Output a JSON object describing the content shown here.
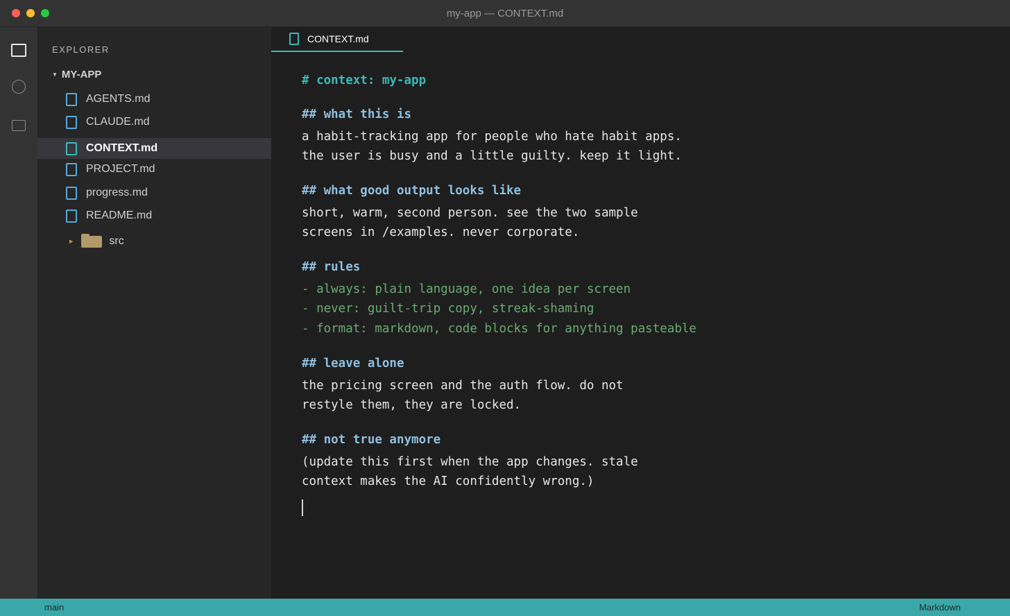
{
  "window": {
    "title": "my-app — CONTEXT.md"
  },
  "activity_bar": {
    "icons": [
      "explorer-icon",
      "search-icon",
      "extensions-icon"
    ]
  },
  "sidebar": {
    "heading": "EXPLORER",
    "root_label": "MY-APP",
    "files": [
      {
        "label": "AGENTS.md",
        "active": false
      },
      {
        "label": "CLAUDE.md",
        "active": false
      },
      {
        "label": "CONTEXT.md",
        "active": true
      },
      {
        "label": "PROJECT.md",
        "active": false
      },
      {
        "label": "progress.md",
        "active": false
      },
      {
        "label": "README.md",
        "active": false
      }
    ],
    "folder": {
      "label": "src"
    }
  },
  "editor": {
    "tab_label": "CONTEXT.md",
    "lines": {
      "h1": "# context: my-app",
      "h2_what": "## what this is",
      "what_1": "a habit-tracking app for people who hate habit apps.",
      "what_2": "the user is busy and a little guilty. keep it light.",
      "h2_output": "## what good output looks like",
      "output_1": "short, warm, second person. see the two sample",
      "output_2": "screens in /examples. never corporate.",
      "h2_rules": "## rules",
      "rule_1": "- always: plain language, one idea per screen",
      "rule_2": "- never: guilt-trip copy, streak-shaming",
      "rule_3": "- format: markdown, code blocks for anything pasteable",
      "h2_leave": "## leave alone",
      "leave_1": "the pricing screen and the auth flow. do not",
      "leave_2": "restyle them, they are locked.",
      "h2_not_true": "## not true anymore",
      "not_true_1": "(update this first when the app changes. stale",
      "not_true_2": "context makes the AI confidently wrong.)"
    }
  },
  "status_bar": {
    "branch": "main",
    "language": "Markdown"
  },
  "colors": {
    "accent": "#3aa8a8",
    "heading": "#3fb8b8",
    "subheading": "#8fbfe0",
    "list": "#6aab73"
  }
}
